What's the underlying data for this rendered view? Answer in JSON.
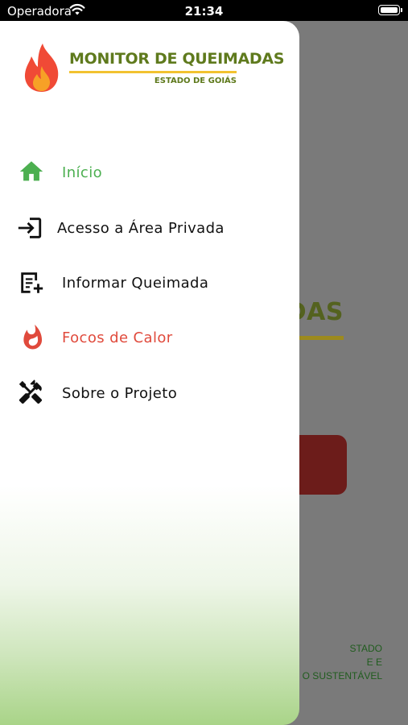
{
  "status_bar": {
    "carrier": "Operadora",
    "time": "21:34"
  },
  "background_app": {
    "title_fragment": "DAS",
    "footer_lines": [
      "STADO",
      "E E",
      "O SUSTENTÁVEL"
    ]
  },
  "drawer": {
    "logo": {
      "title": "MONITOR DE QUEIMADAS",
      "subtitle": "ESTADO DE GOIÁS"
    },
    "menu": [
      {
        "label": "Início",
        "icon": "home-icon",
        "state": "active"
      },
      {
        "label": "Acesso a Área Privada",
        "icon": "login-icon"
      },
      {
        "label": "Informar Queimada",
        "icon": "report-add-icon"
      },
      {
        "label": "Focos de Calor",
        "icon": "fire-icon"
      },
      {
        "label": "Sobre o Projeto",
        "icon": "tools-icon"
      }
    ]
  },
  "colors": {
    "active": "#4caf50",
    "fire": "#e04a3c",
    "brand_green": "#5f7a1d",
    "accent_yellow": "#f2c230"
  }
}
